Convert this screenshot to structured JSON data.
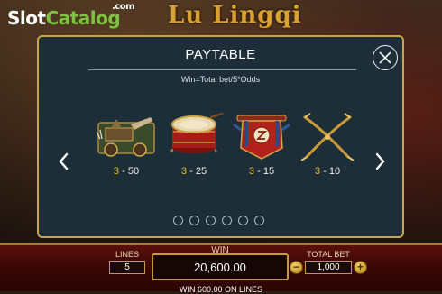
{
  "watermark": {
    "slot": "Slot",
    "catalog": "Catalog",
    "com": ".com"
  },
  "game": {
    "title": "Lu Lingqi"
  },
  "paytable": {
    "title": "PAYTABLE",
    "subtitle": "Win=Total bet/5*Odds",
    "symbols": [
      {
        "icon": "war-cart-icon",
        "count": "3",
        "sep": " - ",
        "odds": "50"
      },
      {
        "icon": "war-drum-icon",
        "count": "3",
        "sep": " - ",
        "odds": "25"
      },
      {
        "icon": "banner-flag-icon",
        "count": "3",
        "sep": " - ",
        "odds": "15"
      },
      {
        "icon": "crossed-bows-icon",
        "count": "3",
        "sep": " - ",
        "odds": "10"
      }
    ],
    "pages": 6,
    "active_page": 1
  },
  "bottom": {
    "lines_label": "LINES",
    "lines_value": "5",
    "win_label": "WIN",
    "win_value": "20,600.00",
    "totalbet_label": "TOTAL BET",
    "totalbet_value": "1,000",
    "minus_label": "−",
    "plus_label": "+",
    "win_lines_text": "WIN 600.00 ON LINES"
  },
  "colors": {
    "accent_gold": "#c9a64a",
    "panel": "#1e2e38",
    "odds_count": "#e6c229",
    "logo_green": "#7dc242"
  }
}
